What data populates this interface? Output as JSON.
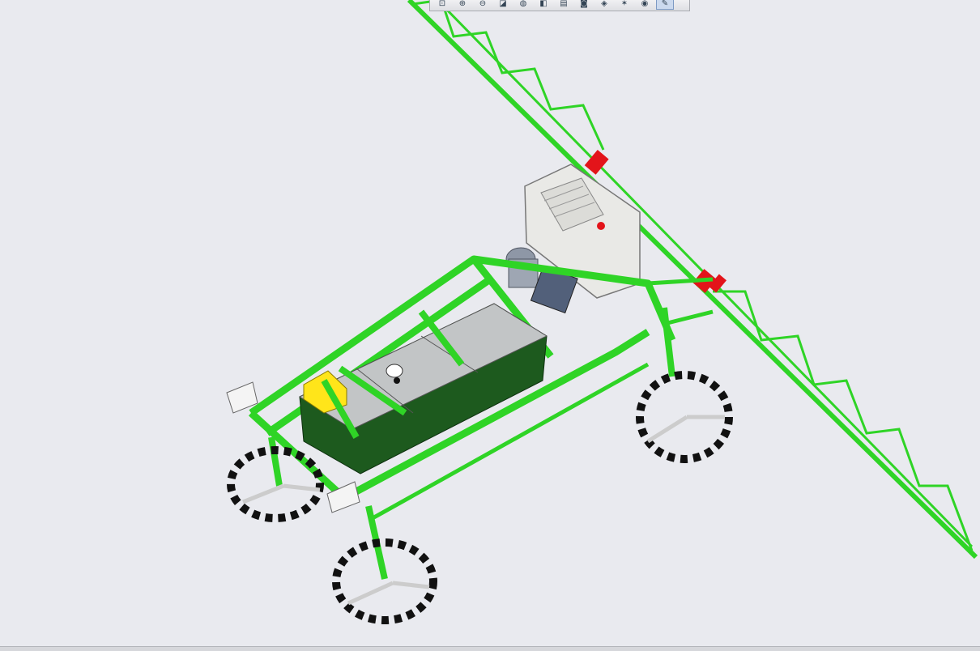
{
  "viewer": {
    "toolbar": {
      "buttons": [
        {
          "icon": "zoom-area-icon",
          "glyph": "⊡"
        },
        {
          "icon": "zoom-in-icon",
          "glyph": "⊕"
        },
        {
          "icon": "zoom-out-icon",
          "glyph": "⊖"
        },
        {
          "icon": "rotate-icon",
          "glyph": "◪"
        },
        {
          "icon": "shading-icon",
          "glyph": "◍"
        },
        {
          "icon": "view-orientation-icon",
          "glyph": "◧"
        },
        {
          "icon": "sheet-icon",
          "glyph": "▤"
        },
        {
          "icon": "camera-icon",
          "glyph": "◙"
        },
        {
          "icon": "display-style-icon",
          "glyph": "◈"
        },
        {
          "icon": "hide-show-icon",
          "glyph": "✶"
        },
        {
          "icon": "eye-icon",
          "glyph": "◉"
        },
        {
          "icon": "sketch-tool-icon",
          "glyph": "✎"
        }
      ]
    },
    "model": {
      "frame_color": "#2fd426",
      "frame_dark": "#1d9a17",
      "tank_color": "#1d5a1e",
      "wheel_color": "#111111",
      "housing_color": "#e9e9e6",
      "clamp_color": "#e3141a",
      "battery_color": "#ffe51a",
      "motor_color": "#8e97a6"
    }
  }
}
